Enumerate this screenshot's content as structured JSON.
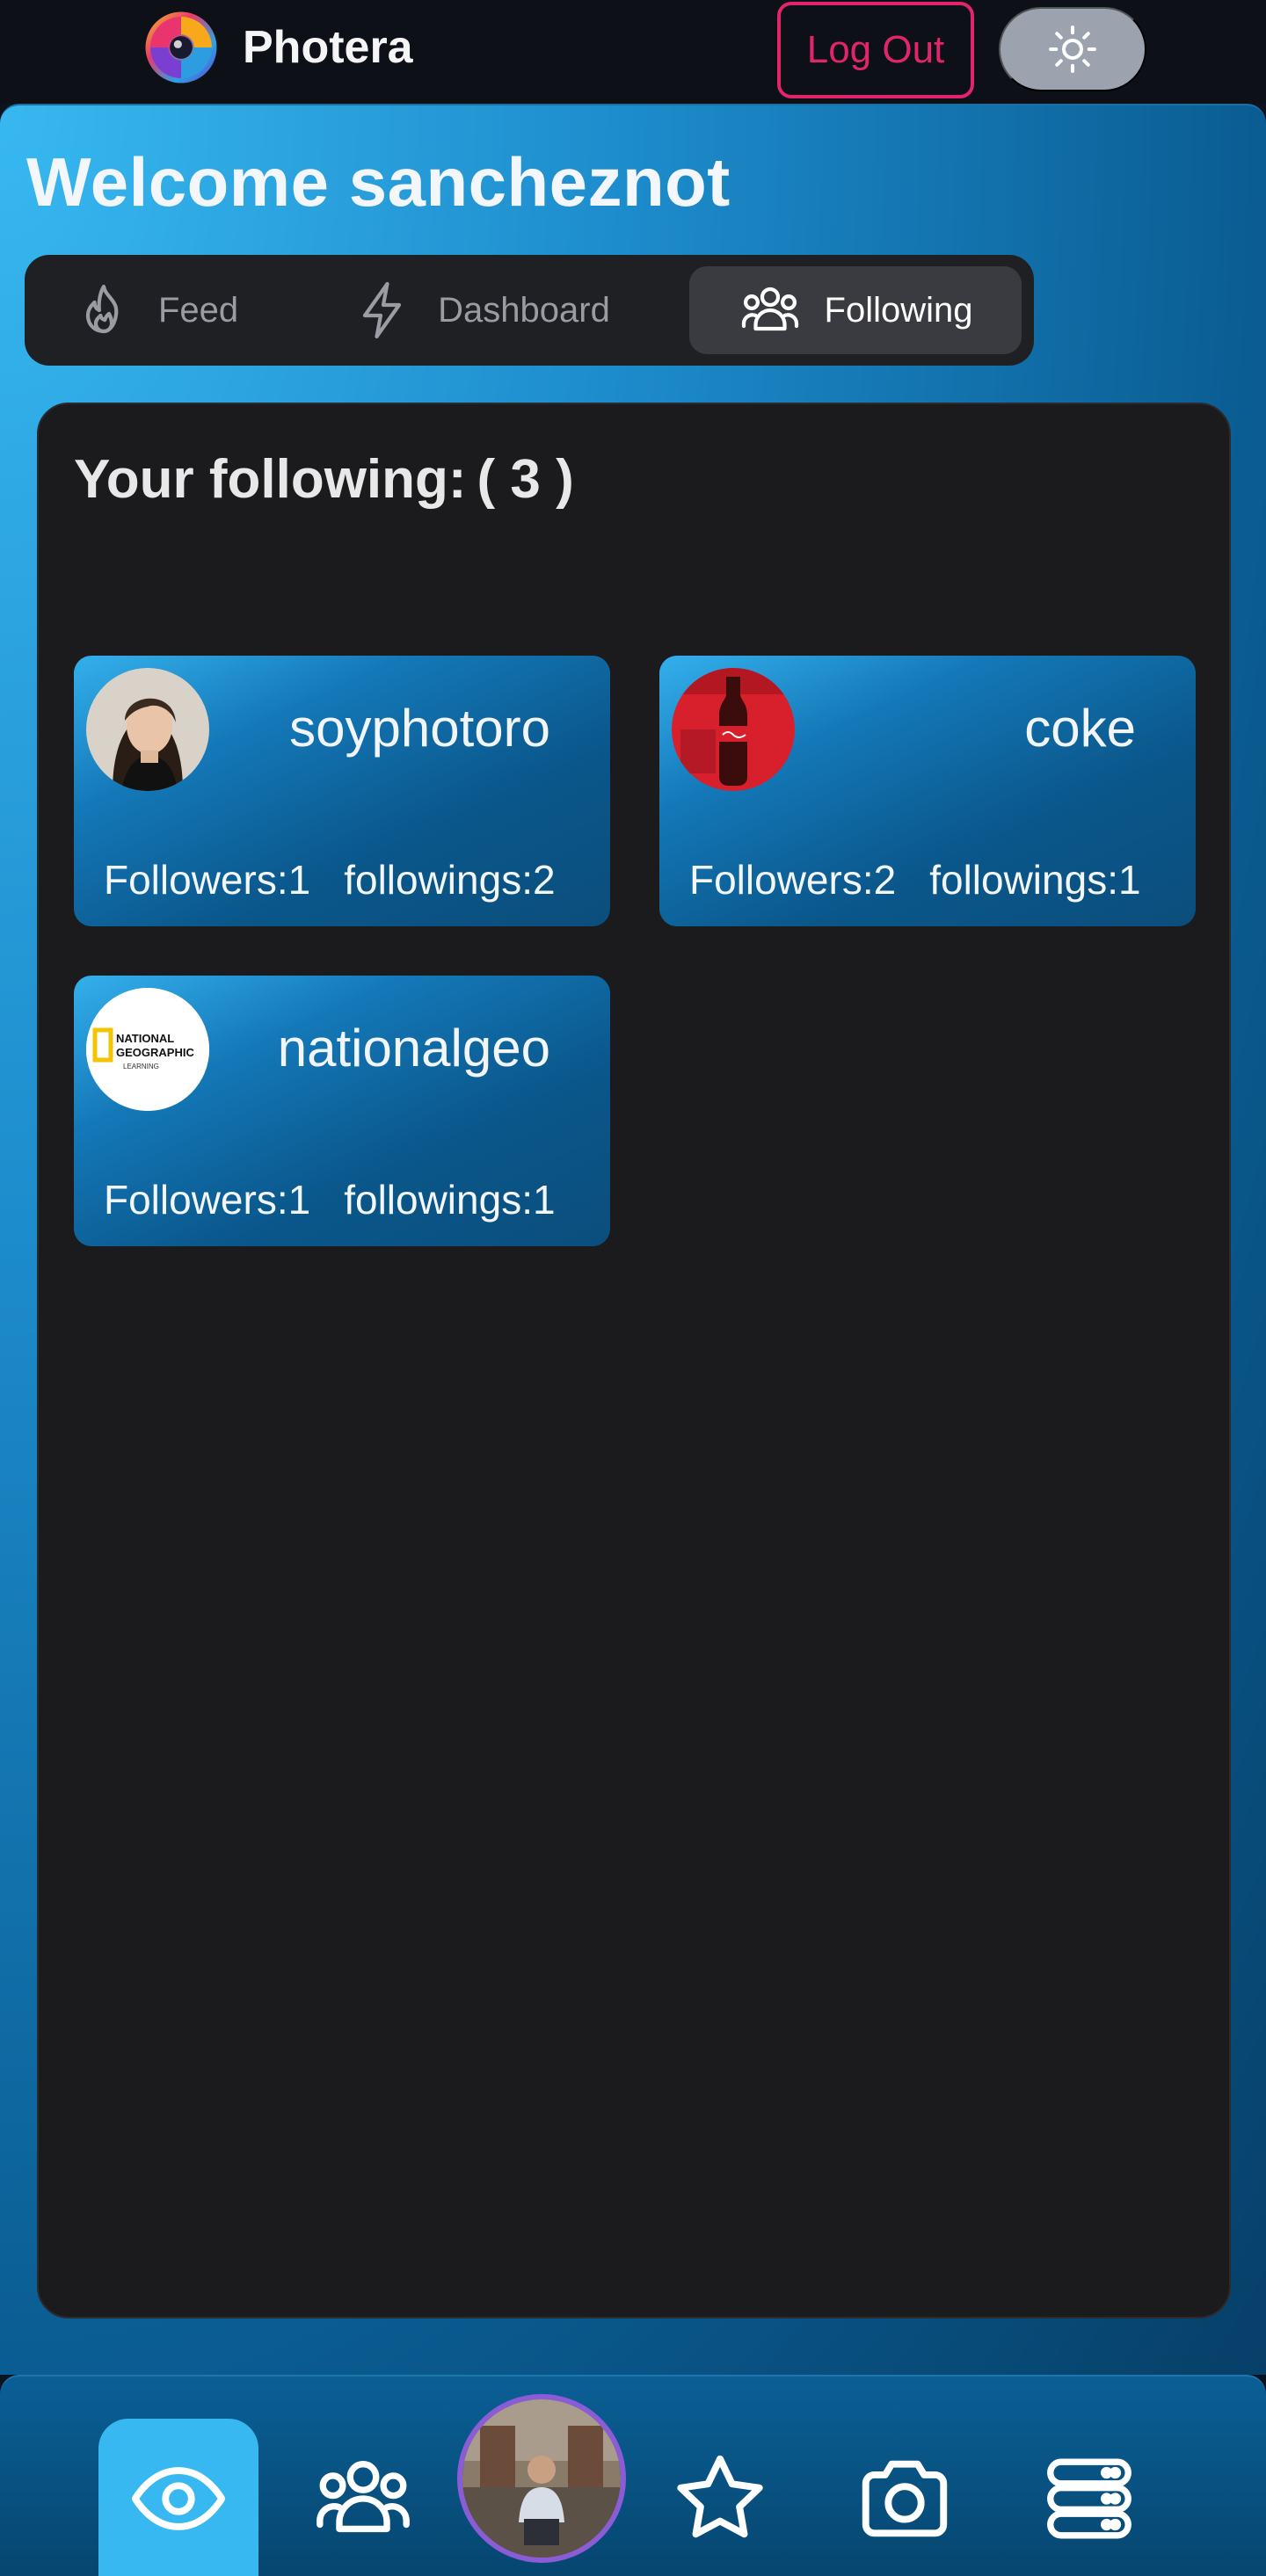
{
  "app": {
    "name": "Photera",
    "logout_label": "Log Out"
  },
  "header": {
    "welcome": "Welcome sancheznot"
  },
  "tabs": [
    {
      "label": "Feed",
      "icon": "flame-icon",
      "active": false
    },
    {
      "label": "Dashboard",
      "icon": "lightning-icon",
      "active": false
    },
    {
      "label": "Following",
      "icon": "users-icon",
      "active": true
    }
  ],
  "following": {
    "title": "Your following:",
    "count": "( 3 )",
    "users": [
      {
        "username": "soyphotoro",
        "followers": "Followers:1",
        "followings": "followings:2",
        "avatar": "portrait-avatar"
      },
      {
        "username": "coke",
        "followers": "Followers:2",
        "followings": "followings:1",
        "avatar": "coca-cola-avatar"
      },
      {
        "username": "nationalgeo",
        "followers": "Followers:1",
        "followings": "followings:1",
        "avatar": "national-geographic-avatar",
        "avatar_text": [
          "NATIONAL",
          "GEOGRAPHIC",
          "LEARNING"
        ]
      }
    ]
  },
  "bottom_nav": [
    {
      "icon": "eye-icon",
      "active": true
    },
    {
      "icon": "users-icon",
      "active": false
    },
    {
      "icon": "profile-avatar",
      "active": false
    },
    {
      "icon": "star-icon",
      "active": false
    },
    {
      "icon": "camera-icon",
      "active": false
    },
    {
      "icon": "server-icon",
      "active": false
    }
  ],
  "colors": {
    "accent": "#38b8f0",
    "logout": "#e0246e",
    "panel": "#1b1b1e",
    "avatar_ring": "#8b5cd6"
  }
}
